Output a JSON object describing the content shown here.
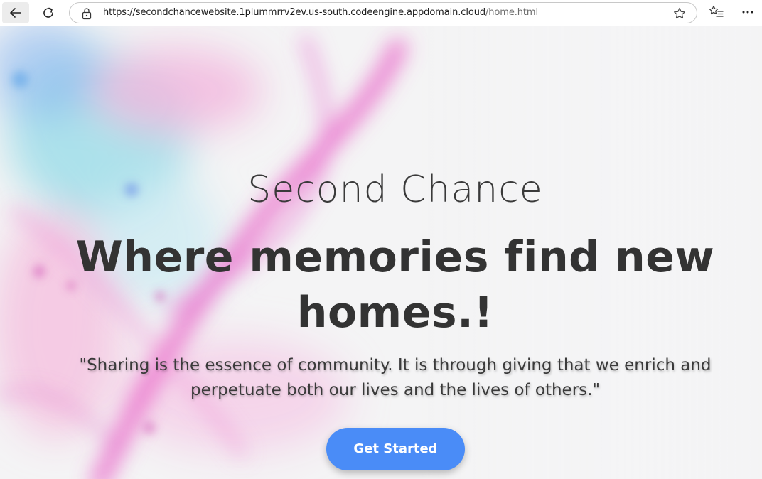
{
  "browser": {
    "url_host": "https://secondchancewebsite.1plummrrv2ev.us-south.codeengine.appdomain.cloud",
    "url_path": "/home.html",
    "icons": [
      "back-arrow-icon",
      "reload-icon",
      "lock-icon",
      "star-icon",
      "favorites-icon",
      "more-icon"
    ]
  },
  "hero": {
    "brand": "Second Chance",
    "headline": "Where memories find new homes.!",
    "quote": "\"Sharing is the essence of community. It is through giving that we enrich and perpetuate both our lives and the lives of others.\"",
    "cta_label": "Get Started",
    "colors": {
      "cta": "#4a8cf7",
      "text": "#333333",
      "accent_pink": "#e85dc6",
      "accent_cyan": "#7fd6e6"
    }
  }
}
